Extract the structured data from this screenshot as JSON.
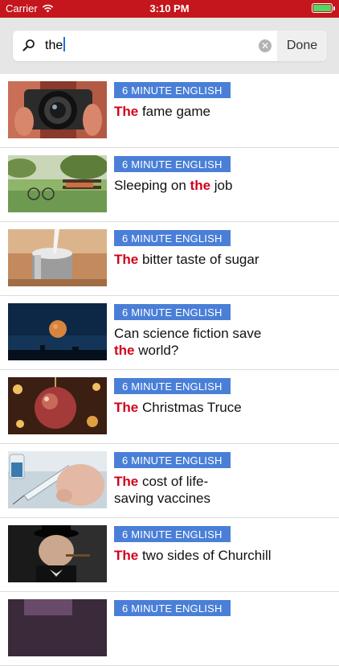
{
  "status": {
    "carrier": "Carrier",
    "time": "3:10 PM"
  },
  "search": {
    "query": "the",
    "done_label": "Done"
  },
  "colors": {
    "status_bar": "#c4161c",
    "badge": "#4a7fd8",
    "highlight": "#d0021b"
  },
  "results": [
    {
      "category": "6 MINUTE ENGLISH",
      "lines": [
        [
          {
            "text": "The",
            "hl": true
          },
          {
            "text": " fame game"
          }
        ]
      ]
    },
    {
      "category": "6 MINUTE ENGLISH",
      "lines": [
        [
          {
            "text": "Sleeping on "
          },
          {
            "text": "the",
            "hl": true
          },
          {
            "text": " job"
          }
        ]
      ]
    },
    {
      "category": "6 MINUTE ENGLISH",
      "lines": [
        [
          {
            "text": "The",
            "hl": true
          },
          {
            "text": " bitter taste of sugar"
          }
        ]
      ]
    },
    {
      "category": "6 MINUTE ENGLISH",
      "lines": [
        [
          {
            "text": "Can science fiction save"
          }
        ],
        [
          {
            "text": "the",
            "hl": true
          },
          {
            "text": " world?"
          }
        ]
      ]
    },
    {
      "category": "6 MINUTE ENGLISH",
      "lines": [
        [
          {
            "text": "The",
            "hl": true
          },
          {
            "text": " Christmas Truce"
          }
        ]
      ]
    },
    {
      "category": "6 MINUTE ENGLISH",
      "lines": [
        [
          {
            "text": "The",
            "hl": true
          },
          {
            "text": " cost of life-"
          }
        ],
        [
          {
            "text": "saving vaccines"
          }
        ]
      ]
    },
    {
      "category": "6 MINUTE ENGLISH",
      "lines": [
        [
          {
            "text": "The",
            "hl": true
          },
          {
            "text": " two sides of Churchill"
          }
        ]
      ]
    },
    {
      "category": "6 MINUTE ENGLISH",
      "lines": []
    }
  ]
}
